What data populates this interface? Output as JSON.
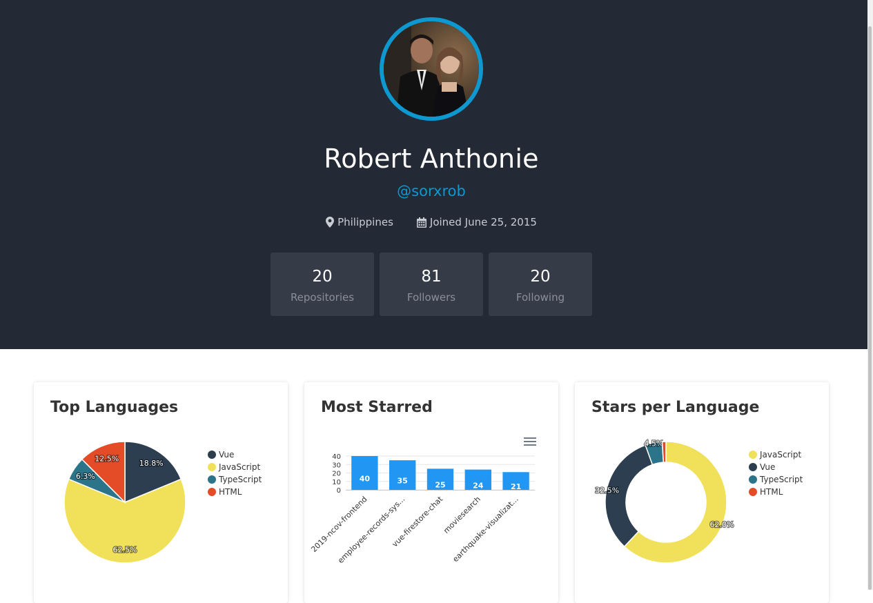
{
  "profile": {
    "name": "Robert Anthonie",
    "handle": "@sorxrob",
    "location": "Philippines",
    "joined": "Joined June 25, 2015"
  },
  "stats": [
    {
      "value": "20",
      "label": "Repositories"
    },
    {
      "value": "81",
      "label": "Followers"
    },
    {
      "value": "20",
      "label": "Following"
    }
  ],
  "colors": {
    "header_bg": "#242a35",
    "accent": "#0e98d0",
    "stat_bg": "#353b47",
    "vue": "#2c3e50",
    "javascript": "#f1e05a",
    "typescript": "#2b7489",
    "html": "#e34c26",
    "bar": "#2196f3"
  },
  "icons": {
    "location": "map-marker-icon",
    "calendar": "calendar-icon",
    "menu": "hamburger-menu-icon"
  },
  "cards": {
    "top_languages_title": "Top Languages",
    "most_starred_title": "Most Starred",
    "stars_per_language_title": "Stars per Language"
  },
  "chart_data": [
    {
      "type": "pie",
      "title": "Top Languages",
      "labels": [
        "Vue",
        "JavaScript",
        "TypeScript",
        "HTML"
      ],
      "values": [
        18.8,
        62.5,
        6.3,
        12.5
      ],
      "slice_labels": [
        "18.8%",
        "62.5%",
        "6.3%",
        "12.5%"
      ],
      "legend": [
        "Vue",
        "JavaScript",
        "TypeScript",
        "HTML"
      ],
      "legend_position": "right"
    },
    {
      "type": "bar",
      "title": "Most Starred",
      "categories": [
        "2019-ncov-frontend",
        "employee-records-sys...",
        "vue-firestore-chat",
        "moviesearch",
        "earthquake-visualizat..."
      ],
      "values": [
        40,
        35,
        25,
        24,
        21
      ],
      "ylim": [
        0,
        40
      ],
      "yticks": [
        "0",
        "10",
        "20",
        "30",
        "40"
      ],
      "grid": true
    },
    {
      "type": "pie",
      "title": "Stars per Language",
      "donut": true,
      "labels": [
        "JavaScript",
        "Vue",
        "TypeScript",
        "HTML"
      ],
      "values": [
        62.0,
        32.5,
        4.5,
        1.0
      ],
      "slice_labels": [
        "62.0%",
        "32.5%",
        "4.5%",
        ""
      ],
      "legend": [
        "JavaScript",
        "Vue",
        "TypeScript",
        "HTML"
      ],
      "legend_position": "right"
    }
  ]
}
